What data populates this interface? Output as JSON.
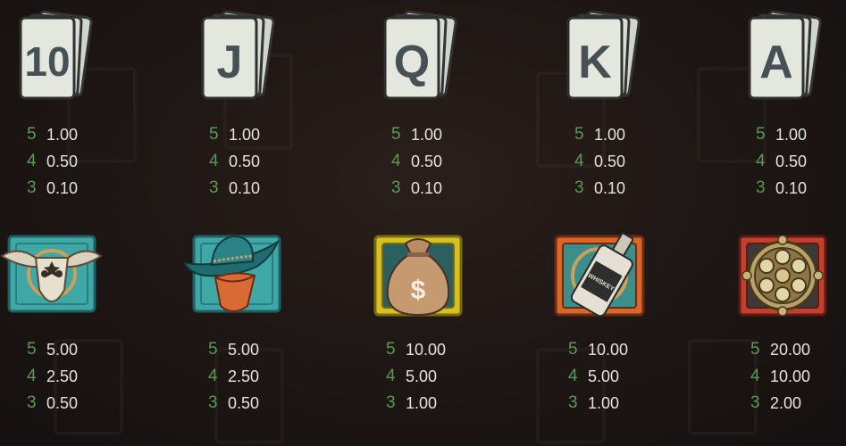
{
  "paytable": {
    "row1": [
      {
        "symbol": "10",
        "icon": "card-10-icon",
        "pays": [
          {
            "count": "5",
            "value": "1.00"
          },
          {
            "count": "4",
            "value": "0.50"
          },
          {
            "count": "3",
            "value": "0.10"
          }
        ]
      },
      {
        "symbol": "J",
        "icon": "card-j-icon",
        "pays": [
          {
            "count": "5",
            "value": "1.00"
          },
          {
            "count": "4",
            "value": "0.50"
          },
          {
            "count": "3",
            "value": "0.10"
          }
        ]
      },
      {
        "symbol": "Q",
        "icon": "card-q-icon",
        "pays": [
          {
            "count": "5",
            "value": "1.00"
          },
          {
            "count": "4",
            "value": "0.50"
          },
          {
            "count": "3",
            "value": "0.10"
          }
        ]
      },
      {
        "symbol": "K",
        "icon": "card-k-icon",
        "pays": [
          {
            "count": "5",
            "value": "1.00"
          },
          {
            "count": "4",
            "value": "0.50"
          },
          {
            "count": "3",
            "value": "0.10"
          }
        ]
      },
      {
        "symbol": "A",
        "icon": "card-a-icon",
        "pays": [
          {
            "count": "5",
            "value": "1.00"
          },
          {
            "count": "4",
            "value": "0.50"
          },
          {
            "count": "3",
            "value": "0.10"
          }
        ]
      }
    ],
    "row2": [
      {
        "icon": "bull-skull-icon",
        "tile_color": "#3fa7a6",
        "pays": [
          {
            "count": "5",
            "value": "5.00"
          },
          {
            "count": "4",
            "value": "2.50"
          },
          {
            "count": "3",
            "value": "0.50"
          }
        ]
      },
      {
        "icon": "cowboy-bandit-icon",
        "tile_color": "#3fa7a6",
        "pays": [
          {
            "count": "5",
            "value": "5.00"
          },
          {
            "count": "4",
            "value": "2.50"
          },
          {
            "count": "3",
            "value": "0.50"
          }
        ]
      },
      {
        "icon": "money-bag-icon",
        "tile_color": "#d8c022",
        "pays": [
          {
            "count": "5",
            "value": "10.00"
          },
          {
            "count": "4",
            "value": "5.00"
          },
          {
            "count": "3",
            "value": "1.00"
          }
        ]
      },
      {
        "icon": "whiskey-bottle-icon",
        "tile_color": "#d9672a",
        "pays": [
          {
            "count": "5",
            "value": "10.00"
          },
          {
            "count": "4",
            "value": "5.00"
          },
          {
            "count": "3",
            "value": "1.00"
          }
        ]
      },
      {
        "icon": "revolver-cylinder-icon",
        "tile_color": "#c4402e",
        "pays": [
          {
            "count": "5",
            "value": "20.00"
          },
          {
            "count": "4",
            "value": "10.00"
          },
          {
            "count": "3",
            "value": "2.00"
          }
        ]
      }
    ]
  },
  "colors": {
    "count": "#5a9a52",
    "value": "#e6e3dc",
    "background": "#1d1614"
  },
  "whiskey_label": "WHISKEY",
  "dollar_sign": "$"
}
